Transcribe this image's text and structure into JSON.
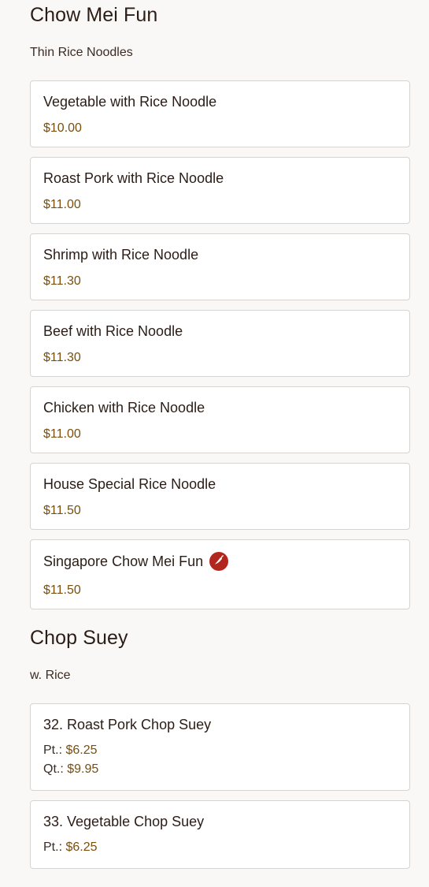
{
  "sections": [
    {
      "title": "Chow Mei Fun",
      "subtitle": "Thin Rice Noodles",
      "items": [
        {
          "name": "Vegetable with Rice Noodle",
          "price": "$10.00"
        },
        {
          "name": "Roast Pork with Rice Noodle",
          "price": "$11.00"
        },
        {
          "name": "Shrimp with Rice Noodle",
          "price": "$11.30"
        },
        {
          "name": "Beef with Rice Noodle",
          "price": "$11.30"
        },
        {
          "name": "Chicken with Rice Noodle",
          "price": "$11.00"
        },
        {
          "name": "House Special Rice Noodle",
          "price": "$11.50"
        },
        {
          "name": "Singapore Chow Mei Fun",
          "price": "$11.50",
          "icon": "spicy-icon"
        }
      ]
    },
    {
      "title": "Chop Suey",
      "subtitle": "w. Rice",
      "items": [
        {
          "name": "32. Roast Pork Chop Suey",
          "prices": [
            {
              "label": "Pt.:",
              "price": "$6.25"
            },
            {
              "label": "Qt.:",
              "price": "$9.95"
            }
          ]
        },
        {
          "name": "33. Vegetable Chop Suey",
          "prices": [
            {
              "label": "Pt.:",
              "price": "$6.25"
            }
          ]
        }
      ]
    }
  ],
  "colors": {
    "price": "#7a4f0e",
    "spicy": "#b3261e",
    "background": "#faf8f6"
  }
}
